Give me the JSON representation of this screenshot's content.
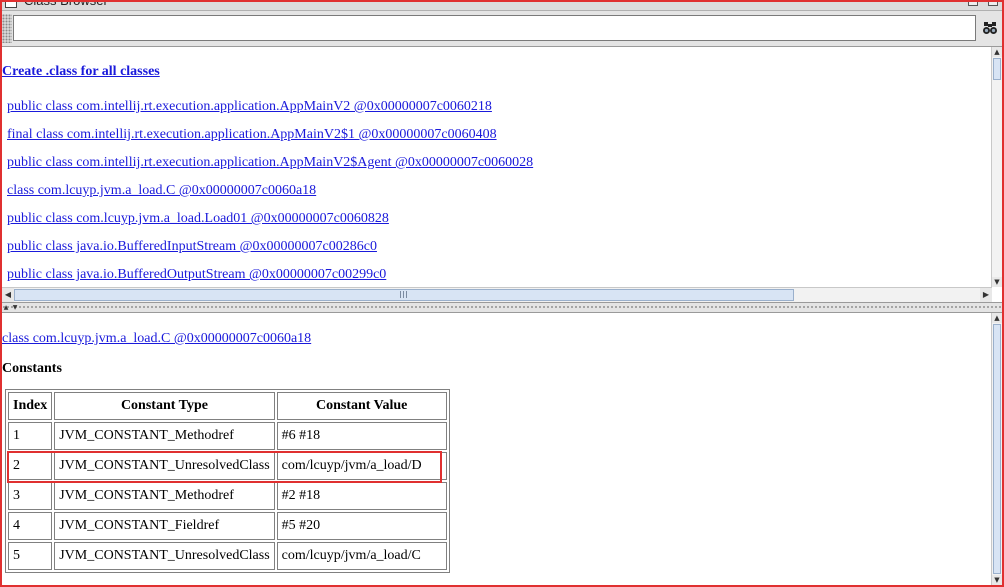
{
  "window": {
    "title": "Class Browser"
  },
  "toolbar": {
    "search_value": "",
    "find_icon": "binoculars-icon"
  },
  "class_list": {
    "create_link": "Create .class for all classes",
    "items": [
      "public class com.intellij.rt.execution.application.AppMainV2 @0x00000007c0060218",
      "final class com.intellij.rt.execution.application.AppMainV2$1 @0x00000007c0060408",
      "public class com.intellij.rt.execution.application.AppMainV2$Agent @0x00000007c0060028",
      "class com.lcuyp.jvm.a_load.C @0x00000007c0060a18",
      "public class com.lcuyp.jvm.a_load.Load01 @0x00000007c0060828",
      "public class java.io.BufferedInputStream @0x00000007c00286c0",
      "public class java.io.BufferedOutputStream @0x00000007c00299c0"
    ]
  },
  "details": {
    "class_link": "class com.lcuyp.jvm.a_load.C @0x00000007c0060a18",
    "section_title": "Constants",
    "headers": [
      "Index",
      "Constant Type",
      "Constant Value"
    ],
    "rows": [
      [
        "1",
        "JVM_CONSTANT_Methodref",
        "#6 #18"
      ],
      [
        "2",
        "JVM_CONSTANT_UnresolvedClass",
        "com/lcuyp/jvm/a_load/D"
      ],
      [
        "3",
        "JVM_CONSTANT_Methodref",
        "#2 #18"
      ],
      [
        "4",
        "JVM_CONSTANT_Fieldref",
        "#5 #20"
      ],
      [
        "5",
        "JVM_CONSTANT_UnresolvedClass",
        "com/lcuyp/jvm/a_load/C"
      ]
    ]
  },
  "colors": {
    "link": "#1a1adb",
    "highlight": "#e03030"
  }
}
